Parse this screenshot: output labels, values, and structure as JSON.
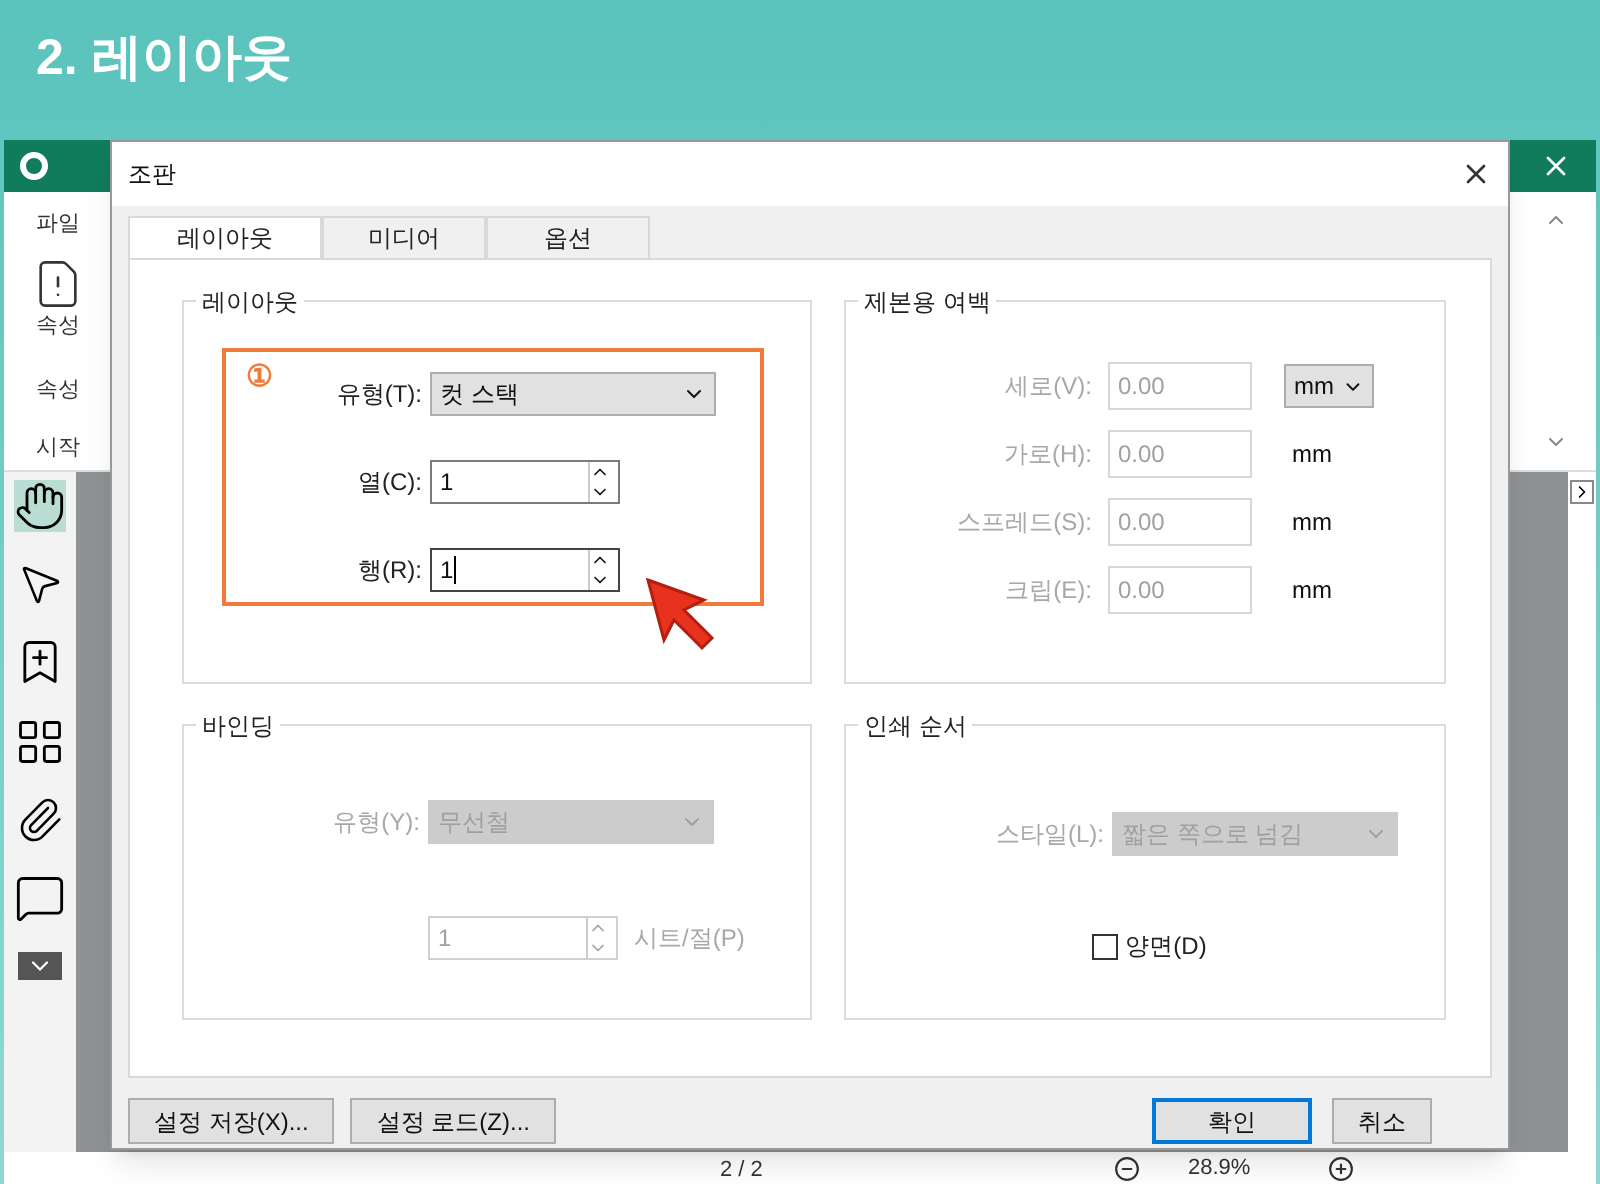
{
  "banner": {
    "title": "2. 레이아웃"
  },
  "app": {
    "menu_tab": "파일",
    "ribbon_button": "속성",
    "ribbon_group": "속성",
    "nav_tab": "시작",
    "page_indicator": "2 / 2",
    "zoom": "28.9%"
  },
  "dialog": {
    "title": "조판",
    "tabs": [
      {
        "label": "레이아웃",
        "selected": true
      },
      {
        "label": "미디어",
        "selected": false
      },
      {
        "label": "옵션",
        "selected": false
      }
    ],
    "groups": [
      {
        "title": "레이아웃",
        "highlighted": true,
        "rows": [
          {
            "kind": "select",
            "label": "유형(T):",
            "value": "컷 스택",
            "disabled": false
          },
          {
            "kind": "spin",
            "label": "열(C):",
            "value": "1",
            "disabled": false
          },
          {
            "kind": "spin",
            "label": "행(R):",
            "value": "1",
            "disabled": false,
            "focused": true
          }
        ]
      },
      {
        "title": "제본용 여백",
        "highlighted": false,
        "rows": [
          {
            "kind": "text",
            "label": "세로(V):",
            "value": "0.00",
            "disabled": true,
            "unit": {
              "kind": "select",
              "text": "mm"
            }
          },
          {
            "kind": "text",
            "label": "가로(H):",
            "value": "0.00",
            "disabled": true,
            "unit": {
              "kind": "label",
              "text": "mm"
            }
          },
          {
            "kind": "text",
            "label": "스프레드(S):",
            "value": "0.00",
            "disabled": true,
            "unit": {
              "kind": "label",
              "text": "mm"
            }
          },
          {
            "kind": "text",
            "label": "크립(E):",
            "value": "0.00",
            "disabled": true,
            "unit": {
              "kind": "label",
              "text": "mm"
            }
          }
        ]
      },
      {
        "title": "바인딩",
        "highlighted": false,
        "rows": [
          {
            "kind": "select",
            "label": "유형(Y):",
            "value": "무선철",
            "disabled": true
          },
          {
            "kind": "spin",
            "value": "1",
            "suffix": "시트/절(P)",
            "disabled": true
          }
        ]
      },
      {
        "title": "인쇄 순서",
        "highlighted": false,
        "rows": [
          {
            "kind": "select",
            "label": "스타일(L):",
            "value": "짧은 쪽으로 넘김",
            "disabled": true
          },
          {
            "kind": "checkbox",
            "label": "양면(D)",
            "checked": false,
            "disabled": false
          }
        ]
      }
    ],
    "callout": {
      "number": "①"
    },
    "footer_left": [
      {
        "label": "설정 저장(X)...",
        "default": false
      },
      {
        "label": "설정 로드(Z)...",
        "default": false
      }
    ],
    "footer_right": [
      {
        "label": "확인",
        "default": true
      },
      {
        "label": "취소",
        "default": false
      }
    ]
  }
}
